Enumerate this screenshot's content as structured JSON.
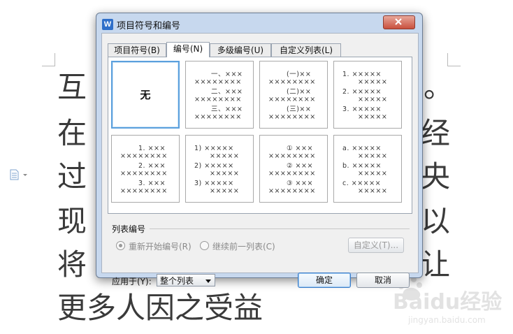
{
  "document": {
    "lines": [
      "互",
      "在",
      "过",
      "现",
      "将",
      "更多人因之受益"
    ],
    "right_fragments": [
      "。",
      "经",
      "央",
      "以",
      "让"
    ]
  },
  "watermark": {
    "brand": "Baidu经验",
    "url": "jingyan.baidu.com"
  },
  "dialog": {
    "title": "项目符号和编号",
    "app_icon": "W",
    "tabs": [
      {
        "label": "项目符号(B)",
        "active": false
      },
      {
        "label": "编号(N)",
        "active": true
      },
      {
        "label": "多级编号(U)",
        "active": false
      },
      {
        "label": "自定义列表(L)",
        "active": false
      }
    ],
    "styles": [
      {
        "label": "无",
        "selected": true
      },
      {
        "lines": [
          "一、×××",
          "××××××××",
          "二、×××",
          "××××××××",
          "三、×××",
          "××××××××"
        ]
      },
      {
        "lines": [
          "(一)××",
          "××××××××",
          "(二)××",
          "××××××××",
          "(三)××",
          "××××××××"
        ]
      },
      {
        "lines": [
          "1.  ×××××",
          "×××××",
          "2.  ×××××",
          "×××××",
          "3.  ×××××",
          "×××××"
        ]
      },
      {
        "lines": [
          "1. ×××",
          "××××××××",
          "2. ×××",
          "××××××××",
          "3. ×××",
          "××××××××"
        ]
      },
      {
        "lines": [
          "1) ×××××",
          "×××××",
          "2) ×××××",
          "×××××",
          "3) ×××××",
          "×××××"
        ]
      },
      {
        "lines": [
          "① ×××",
          "××××××××",
          "② ×××",
          "××××××××",
          "③ ×××",
          "××××××××"
        ]
      },
      {
        "lines": [
          "a.  ×××××",
          "×××××",
          "b.  ×××××",
          "×××××",
          "c.  ×××××",
          "×××××"
        ]
      }
    ],
    "list_numbering": {
      "section_label": "列表编号",
      "restart_label": "重新开始编号(R)",
      "continue_label": "继续前一列表(C)",
      "customize_label": "自定义(T)..."
    },
    "apply_to": {
      "label": "应用于(Y):",
      "value": "整个列表"
    },
    "ok_label": "确定",
    "cancel_label": "取消"
  }
}
